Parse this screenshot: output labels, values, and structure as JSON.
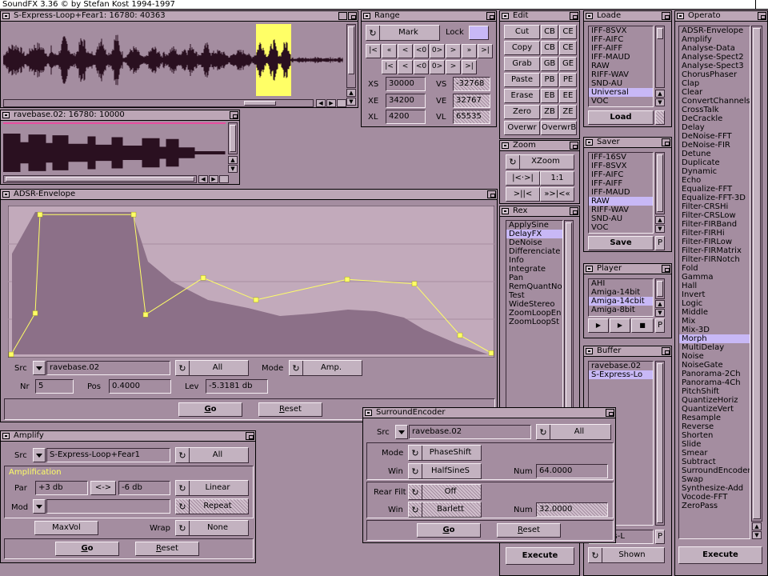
{
  "screen": {
    "title": "SoundFX 3.36 © by Stefan Kost 1994-1997"
  },
  "wave1": {
    "title": "S-Express-Loop+Fear1: 16780:  40363"
  },
  "wave2": {
    "title": "ravebase.02: 16780:  10000"
  },
  "range": {
    "title": "Range",
    "mark": "Mark",
    "lock": "Lock",
    "row1": [
      "|<",
      "«",
      "<",
      "<0",
      "0>",
      ">",
      "»",
      ">|"
    ],
    "row2": [
      "|<",
      "<",
      "<0",
      "0>",
      ">",
      ">|"
    ],
    "labels": {
      "xs": "XS",
      "xe": "XE",
      "xl": "XL",
      "vs": "VS",
      "ve": "VE",
      "vl": "VL"
    },
    "values": {
      "xs": "30000",
      "xe": "34200",
      "xl": "4200",
      "vs": "-32768",
      "ve": "32767",
      "vl": "65535"
    }
  },
  "edit": {
    "title": "Edit",
    "rows": [
      [
        "Cut",
        "CB",
        "CE"
      ],
      [
        "Copy",
        "CB",
        "CE"
      ],
      [
        "Grab",
        "GB",
        "GE"
      ],
      [
        "Paste",
        "PB",
        "PE"
      ],
      [
        "Erase",
        "EB",
        "EE"
      ],
      [
        "Zero",
        "ZB",
        "ZE"
      ],
      [
        "Overwr",
        "OverwrB",
        ""
      ]
    ]
  },
  "zoom": {
    "title": "Zoom",
    "xzoom": "XZoom",
    "b1": "|<·>|",
    "b2": "1:1",
    "b3": ">||<",
    "b4": "»>|<«"
  },
  "rex": {
    "title": "Rex",
    "items": [
      "ApplySine",
      "DelayFX",
      "DeNoise",
      "Differenciate",
      "Info",
      "Integrate",
      "Pan",
      "RemQuantNoi",
      "Test",
      "WideStereo",
      "ZoomLoopEn",
      "ZoomLoopSt"
    ],
    "selected": "DelayFX"
  },
  "loader": {
    "title": "Loade",
    "items": [
      "IFF-8SVX",
      "IFF-AIFC",
      "IFF-AIFF",
      "IFF-MAUD",
      "RAW",
      "RIFF-WAV",
      "SND-AU",
      "Universal",
      "VOC"
    ],
    "selected": "Universal",
    "button": "Load"
  },
  "saver": {
    "title": "Saver",
    "items": [
      "IFF-16SV",
      "IFF-8SVX",
      "IFF-AIFC",
      "IFF-AIFF",
      "IFF-MAUD",
      "RAW",
      "RIFF-WAV",
      "SND-AU",
      "VOC"
    ],
    "selected": "RAW",
    "button": "Save",
    "p": "P"
  },
  "player": {
    "title": "Player",
    "items": [
      "AHI",
      "Amiga-14bit",
      "Amiga-14cbit",
      "Amiga-8bit"
    ],
    "selected": "Amiga-14cbit",
    "play": "▶",
    "pause": "▶",
    "stop": "■",
    "p": "P"
  },
  "buffer": {
    "title": "Buffer",
    "items": [
      "ravebase.02",
      "S-Express-Lo"
    ],
    "selected": "S-Express-Lo",
    "current": "xpress-L",
    "shown": "Shown",
    "p": "P"
  },
  "operators": {
    "title": "Operato",
    "items": [
      "ADSR-Envelope",
      "Amplify",
      "Analyse-Data",
      "Analyse-Spect2",
      "Analyse-Spect3",
      "ChorusPhaser",
      "Clap",
      "Clear",
      "ConvertChannels",
      "CrossTalk",
      "DeCrackle",
      "Delay",
      "DeNoise-FFT",
      "DeNoise-FIR",
      "Detune",
      "Duplicate",
      "Dynamic",
      "Echo",
      "Equalize-FFT",
      "Equalize-FFT-3D",
      "Filter-CRSHi",
      "Filter-CRSLow",
      "Filter-FIRBand",
      "Filter-FIRHi",
      "Filter-FIRLow",
      "Filter-FIRMatrix",
      "Filter-FIRNotch",
      "Fold",
      "Gamma",
      "Hall",
      "Invert",
      "Logic",
      "Middle",
      "Mix",
      "Mix-3D",
      "Morph",
      "MultiDelay",
      "Noise",
      "NoiseGate",
      "Panorama-2Ch",
      "Panorama-4Ch",
      "PitchShift",
      "QuantizeHoriz",
      "QuantizeVert",
      "Resample",
      "Reverse",
      "Shorten",
      "Slide",
      "Smear",
      "Subtract",
      "SurroundEncoder",
      "Swap",
      "Synthesize-Add",
      "Vocode-FFT",
      "ZeroPass"
    ],
    "selected": "Morph",
    "execute": "Execute"
  },
  "rexExecute": "Execute",
  "adsr": {
    "title": "ADSR-Envelope",
    "src_label": "Src",
    "src_value": "ravebase.02",
    "all": "All",
    "mode_label": "Mode",
    "mode_value": "Amp.",
    "nr_label": "Nr",
    "nr_value": "5",
    "pos_label": "Pos",
    "pos_value": "0.4000",
    "lev_label": "Lev",
    "lev_value": "-5.3181 db",
    "go": "Go",
    "reset": "Reset",
    "envelope": [
      [
        0,
        1.0
      ],
      [
        0.05,
        0.72
      ],
      [
        0.06,
        0.05
      ],
      [
        0.255,
        0.05
      ],
      [
        0.28,
        0.73
      ],
      [
        0.4,
        0.48
      ],
      [
        0.51,
        0.63
      ],
      [
        0.7,
        0.49
      ],
      [
        0.84,
        0.52
      ],
      [
        0.935,
        0.87
      ],
      [
        1.0,
        0.99
      ]
    ]
  },
  "amplify": {
    "title": "Amplify",
    "src_label": "Src",
    "src_value": "S-Express-Loop+Fear1",
    "all": "All",
    "section": "Amplification",
    "par_label": "Par",
    "par1": "+3 db",
    "swap": "<->",
    "par2": "-6 db",
    "linear": "Linear",
    "mod_label": "Mod",
    "repeat": "Repeat",
    "maxvol": "MaxVol",
    "wrap_label": "Wrap",
    "wrap_value": "None",
    "go": "Go",
    "reset": "Reset"
  },
  "surround": {
    "title": "SurroundEncoder",
    "src_label": "Src",
    "src_value": "ravebase.02",
    "all": "All",
    "mode_label": "Mode",
    "mode_value": "PhaseShift",
    "win_label": "Win",
    "win_value": "HalfSineS",
    "num_label": "Num",
    "num_value": "64.0000",
    "rearfilt_label": "Rear Filt",
    "rearfilt_value": "Off",
    "win2_label": "Win",
    "win2_value": "Barlett",
    "num2_label": "Num",
    "num2_value": "32.0000",
    "go": "Go",
    "reset": "Reset"
  }
}
